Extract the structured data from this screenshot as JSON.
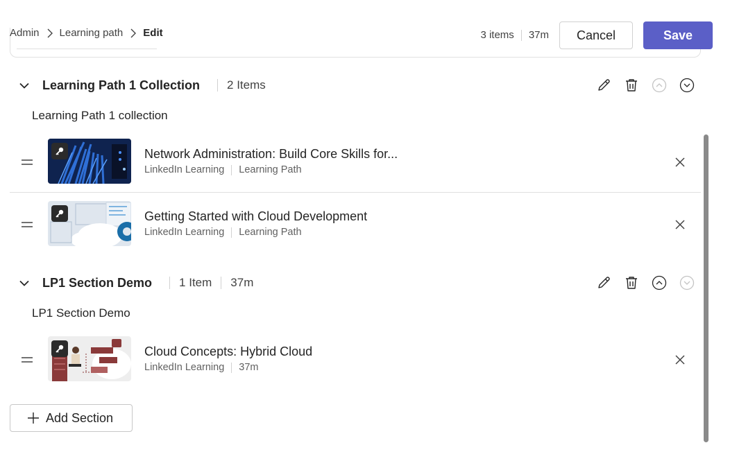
{
  "breadcrumb": {
    "items": [
      "Admin",
      "Learning path"
    ],
    "current": "Edit"
  },
  "header": {
    "items_count": "3 items",
    "duration": "37m",
    "cancel_label": "Cancel",
    "save_label": "Save"
  },
  "accent_color": "#5b5fc7",
  "sections": [
    {
      "title": "Learning Path 1 Collection",
      "count": "2 Items",
      "description": "Learning Path 1 collection",
      "items": [
        {
          "title": "Network Administration: Build Core Skills for...",
          "provider": "LinkedIn Learning",
          "type": "Learning Path",
          "thumb_icon": "key-icon"
        },
        {
          "title": "Getting Started with Cloud Development",
          "provider": "LinkedIn Learning",
          "type": "Learning Path",
          "thumb_icon": "key-icon"
        }
      ]
    },
    {
      "title": "LP1 Section Demo",
      "count": "1 Item",
      "duration": "37m",
      "description": "LP1 Section Demo",
      "items": [
        {
          "title": "Cloud Concepts: Hybrid Cloud",
          "provider": "LinkedIn Learning",
          "duration": "37m",
          "thumb_icon": "key-icon"
        }
      ]
    }
  ],
  "add_section_label": "Add Section"
}
